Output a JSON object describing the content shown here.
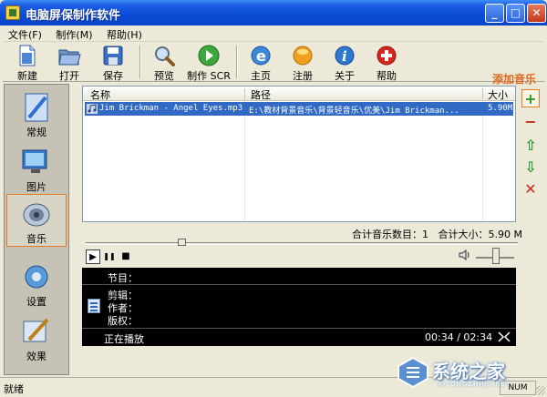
{
  "window": {
    "title": "电脑屏保制作软件",
    "min": "_",
    "max": "□",
    "close": "✕"
  },
  "menu": [
    "文件(F)",
    "制作(M)",
    "帮助(H)"
  ],
  "toolbar": [
    "新建",
    "打开",
    "保存",
    "预览",
    "制作 SCR",
    "主页",
    "注册",
    "关于",
    "帮助"
  ],
  "sidebar": [
    "常规",
    "图片",
    "音乐",
    "设置",
    "效果"
  ],
  "list": {
    "headers": [
      "名称",
      "路径",
      "大小"
    ],
    "rows": [
      {
        "name": "Jim Brickman - Angel Eyes.mp3",
        "path": "E:\\教材背景音乐\\背景轻音乐\\优美\\Jim Brickman...",
        "size": "5.90M"
      }
    ]
  },
  "annotation": "添加音乐",
  "side_buttons": {
    "add": "+",
    "remove": "−",
    "up": "⇧",
    "down": "⇩",
    "delete": "✕"
  },
  "totals": {
    "count_label": "合计音乐数目：1",
    "size_label": "合计大小：5.90 M"
  },
  "player": {
    "play": "▶",
    "pause": "❚❚",
    "stop": "■"
  },
  "info": {
    "program_label": "节目：",
    "edit_label": "剪辑：",
    "author_label": "作者：",
    "copyright_label": "版权：",
    "status": "正在播放",
    "time": "00:34 / 02:34"
  },
  "statusbar": {
    "text": "就绪",
    "num": "NUM"
  },
  "watermark": {
    "text": "系统之家",
    "sub": "XITONGZHIJIA.NET"
  },
  "colors": {
    "accent": "#e87a22",
    "selection": "#316ac5",
    "titlebar": "#0a4ad6"
  }
}
